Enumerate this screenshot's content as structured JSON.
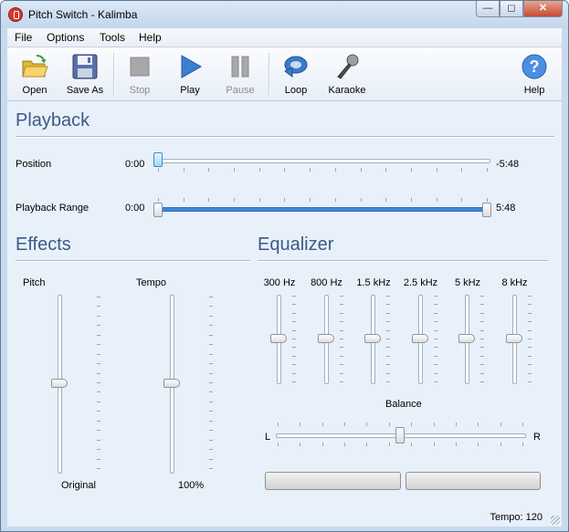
{
  "window": {
    "title": "Pitch Switch - Kalimba"
  },
  "menu": [
    "File",
    "Options",
    "Tools",
    "Help"
  ],
  "toolbar": {
    "buttons": [
      {
        "label": "Open",
        "icon": "folder-open-icon",
        "enabled": true
      },
      {
        "label": "Save As",
        "icon": "floppy-disk-icon",
        "enabled": true
      },
      {
        "label": "Stop",
        "icon": "stop-icon",
        "enabled": false
      },
      {
        "label": "Play",
        "icon": "play-icon",
        "enabled": true
      },
      {
        "label": "Pause",
        "icon": "pause-icon",
        "enabled": false
      },
      {
        "label": "Loop",
        "icon": "loop-icon",
        "enabled": true
      },
      {
        "label": "Karaoke",
        "icon": "microphone-icon",
        "enabled": true
      },
      {
        "label": "Help",
        "icon": "help-icon",
        "enabled": true
      }
    ]
  },
  "playback": {
    "title": "Playback",
    "position": {
      "label": "Position",
      "current": "0:00",
      "remaining": "-5:48",
      "fraction": 0
    },
    "range": {
      "label": "Playback Range",
      "start": "0:00",
      "end": "5:48",
      "start_fraction": 0,
      "end_fraction": 1
    }
  },
  "effects": {
    "title": "Effects",
    "pitch": {
      "label": "Pitch",
      "value": "Original",
      "fraction": 0.5
    },
    "tempo": {
      "label": "Tempo",
      "value": "100%",
      "fraction": 0.5
    }
  },
  "equalizer": {
    "title": "Equalizer",
    "bands": [
      {
        "label": "300 Hz",
        "fraction": 0.5
      },
      {
        "label": "800 Hz",
        "fraction": 0.5
      },
      {
        "label": "1.5 kHz",
        "fraction": 0.5
      },
      {
        "label": "2.5 kHz",
        "fraction": 0.5
      },
      {
        "label": "5 kHz",
        "fraction": 0.5
      },
      {
        "label": "8 kHz",
        "fraction": 0.5
      }
    ],
    "balance": {
      "label": "Balance",
      "left": "L",
      "right": "R",
      "fraction": 0.5
    }
  },
  "status": {
    "tempo": "Tempo: 120"
  }
}
